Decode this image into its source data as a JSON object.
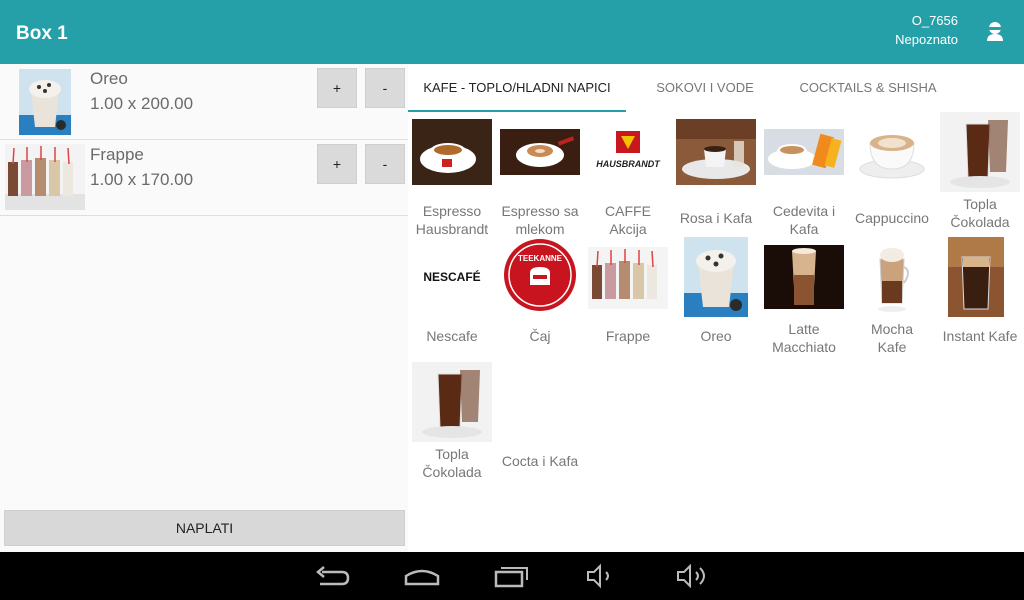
{
  "header": {
    "title": "Box 1",
    "order_id": "O_7656",
    "user_status": "Nepoznato"
  },
  "cart": {
    "items": [
      {
        "name": "Oreo",
        "qty_price": "1.00 x 200.00",
        "plus_label": "+",
        "minus_label": "-"
      },
      {
        "name": "Frappe",
        "qty_price": "1.00 x 170.00",
        "plus_label": "+",
        "minus_label": "-"
      }
    ],
    "pay_label": "NAPLATI"
  },
  "tabs": [
    {
      "label": "KAFE - TOPLO/HLADNI NAPICI",
      "active": true
    },
    {
      "label": "SOKOVI I VODE",
      "active": false
    },
    {
      "label": "COCKTAILS & SHISHA",
      "active": false
    }
  ],
  "products": [
    {
      "label": "Espresso\nHausbrandt"
    },
    {
      "label": "Espresso sa\nmlekom"
    },
    {
      "label": "CAFFE\nAkcija"
    },
    {
      "label": "Rosa i Kafa"
    },
    {
      "label": "Cedevita i\nKafa"
    },
    {
      "label": "Cappuccino"
    },
    {
      "label": "Topla\nČokolada"
    },
    {
      "label": "Nescafe"
    },
    {
      "label": "Čaj"
    },
    {
      "label": "Frappe"
    },
    {
      "label": "Oreo"
    },
    {
      "label": "Latte\nMacchiato"
    },
    {
      "label": "Mocha\nKafe"
    },
    {
      "label": "Instant Kafe"
    },
    {
      "label": "Topla\nČokolada"
    },
    {
      "label": "Cocta i Kafa"
    }
  ],
  "logos": {
    "hausbrandt": "HAUSBRANDT",
    "nescafe": "NESCAFÉ",
    "teekanne": "TEEKANNE"
  },
  "colors": {
    "accent": "#26a0a8",
    "navbar": "#000000"
  },
  "icons": {
    "user": "user-icon",
    "back": "back-icon",
    "home": "home-icon",
    "recents": "recents-icon",
    "volume_down": "volume-down-icon",
    "volume_up": "volume-up-icon"
  }
}
